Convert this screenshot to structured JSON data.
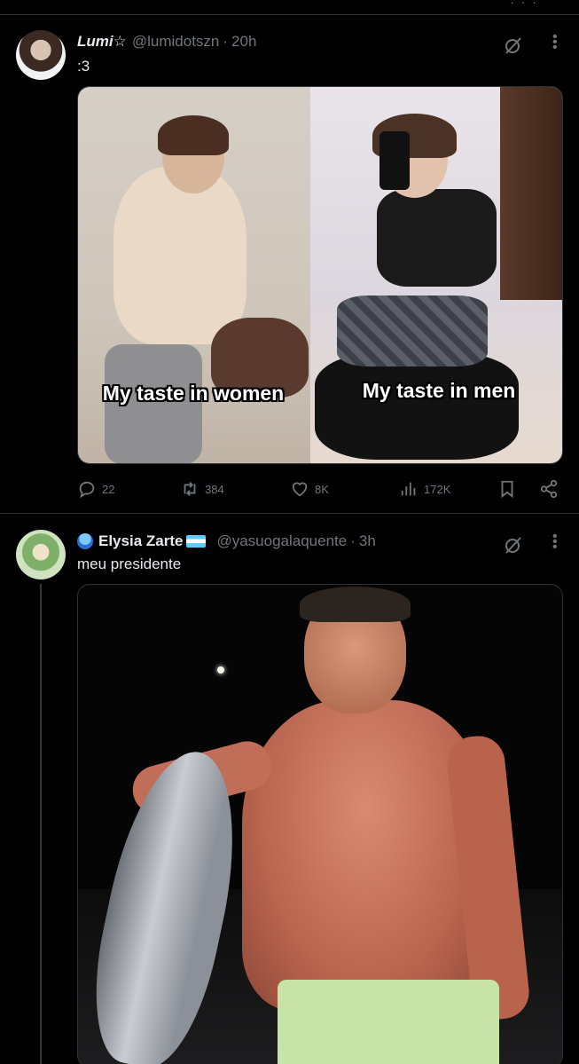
{
  "top": {
    "more_symbol": "· · ·"
  },
  "tweets": [
    {
      "name": "Lumi☆",
      "handle": "@lumidotszn",
      "separator": "·",
      "time": "20h",
      "text": ":3",
      "media": {
        "left_caption": "My taste in women",
        "right_caption": "My taste in men"
      },
      "actions": {
        "replies": "22",
        "reposts": "384",
        "likes": "8K",
        "views": "172K"
      },
      "icons": [
        "grok-icon",
        "more-icon",
        "reply-icon",
        "retweet-icon",
        "like-icon",
        "views-icon",
        "bookmark-icon",
        "share-icon"
      ]
    },
    {
      "name": "Elysia Zarte",
      "handle": "@yasuogalaquente",
      "separator": "·",
      "time": "3h",
      "text": "meu presidente",
      "badges": [
        "cloud-emoji-icon",
        "trans-flag-icon"
      ],
      "icons": [
        "grok-icon",
        "more-icon"
      ]
    }
  ],
  "colors": {
    "background": "#000000",
    "divider": "#2f3336",
    "text_primary": "#e7e9ea",
    "text_secondary": "#71767b"
  }
}
